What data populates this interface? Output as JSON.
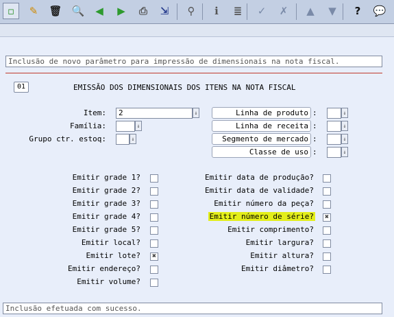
{
  "toolbar": {
    "buttons": [
      {
        "name": "new-document-icon",
        "glyph": "▫",
        "color": "#3a9a3a"
      },
      {
        "name": "edit-pencil-icon",
        "glyph": "✎",
        "color": "#d08a00"
      },
      {
        "name": "trash-icon",
        "glyph": "🗑",
        "color": "#222"
      },
      {
        "name": "search-icon",
        "glyph": "🔍",
        "color": "#1a4fb0"
      },
      {
        "name": "previous-icon",
        "glyph": "◀",
        "color": "#2e9a2e"
      },
      {
        "name": "next-icon",
        "glyph": "▶",
        "color": "#2e9a2e"
      },
      {
        "name": "print-icon",
        "glyph": "⎙",
        "color": "#555"
      },
      {
        "name": "import-icon",
        "glyph": "⇲",
        "color": "#2a3f8f"
      },
      {
        "name": "binoculars-icon",
        "glyph": "⚲",
        "color": "#555"
      },
      {
        "name": "info-icon",
        "glyph": "ℹ",
        "color": "#555"
      },
      {
        "name": "numbered-list-icon",
        "glyph": "≣",
        "color": "#555"
      },
      {
        "name": "checkmark-icon",
        "glyph": "✓",
        "color": "#7a8aa8"
      },
      {
        "name": "cancel-x-icon",
        "glyph": "✗",
        "color": "#7a8aa8"
      },
      {
        "name": "first-record-icon",
        "glyph": "▲",
        "color": "#7a8aa8"
      },
      {
        "name": "last-record-icon",
        "glyph": "▼",
        "color": "#7a8aa8"
      },
      {
        "name": "help-icon",
        "glyph": "?",
        "color": "#111"
      },
      {
        "name": "chat-bubble-icon",
        "glyph": "💬",
        "color": "#333"
      }
    ]
  },
  "header": {
    "description": "Inclusão de novo parâmetro para impressão de dimensionais na nota fiscal.",
    "code": "01",
    "title": "EMISSÃO DOS DIMENSIONAIS DOS ITENS NA NOTA FISCAL"
  },
  "form": {
    "item_label": "Item:",
    "item_value": "2",
    "familia_label": "Família:",
    "grupo_label": "Grupo ctr. estoq:",
    "right_labels": [
      "Linha de produto",
      "Linha de receita",
      "Segmento de mercado",
      "Classe de uso"
    ],
    "colon": ":"
  },
  "checkboxes_left": [
    {
      "label": "Emitir grade 1?",
      "checked": false
    },
    {
      "label": "Emitir grade 2?",
      "checked": false
    },
    {
      "label": "Emitir grade 3?",
      "checked": false
    },
    {
      "label": "Emitir grade 4?",
      "checked": false
    },
    {
      "label": "Emitir grade 5?",
      "checked": false
    },
    {
      "label": "Emitir local?",
      "checked": false
    },
    {
      "label": "Emitir lote?",
      "checked": true
    },
    {
      "label": "Emitir endereço?",
      "checked": false
    },
    {
      "label": "Emitir volume?",
      "checked": false
    }
  ],
  "checkboxes_right": [
    {
      "label": "Emitir data de produção?",
      "checked": false
    },
    {
      "label": "Emitir data de validade?",
      "checked": false
    },
    {
      "label": "Emitir número da peça?",
      "checked": false
    },
    {
      "label": "Emitir número de série?",
      "checked": true,
      "highlight": true
    },
    {
      "label": "Emitir comprimento?",
      "checked": false
    },
    {
      "label": "Emitir largura?",
      "checked": false
    },
    {
      "label": "Emitir altura?",
      "checked": false
    },
    {
      "label": "Emitir diâmetro?",
      "checked": false
    }
  ],
  "status": {
    "message": "Inclusão efetuada com sucesso."
  },
  "colors": {
    "highlight": "#e3ee1a",
    "separator_line": "#c0392b"
  }
}
